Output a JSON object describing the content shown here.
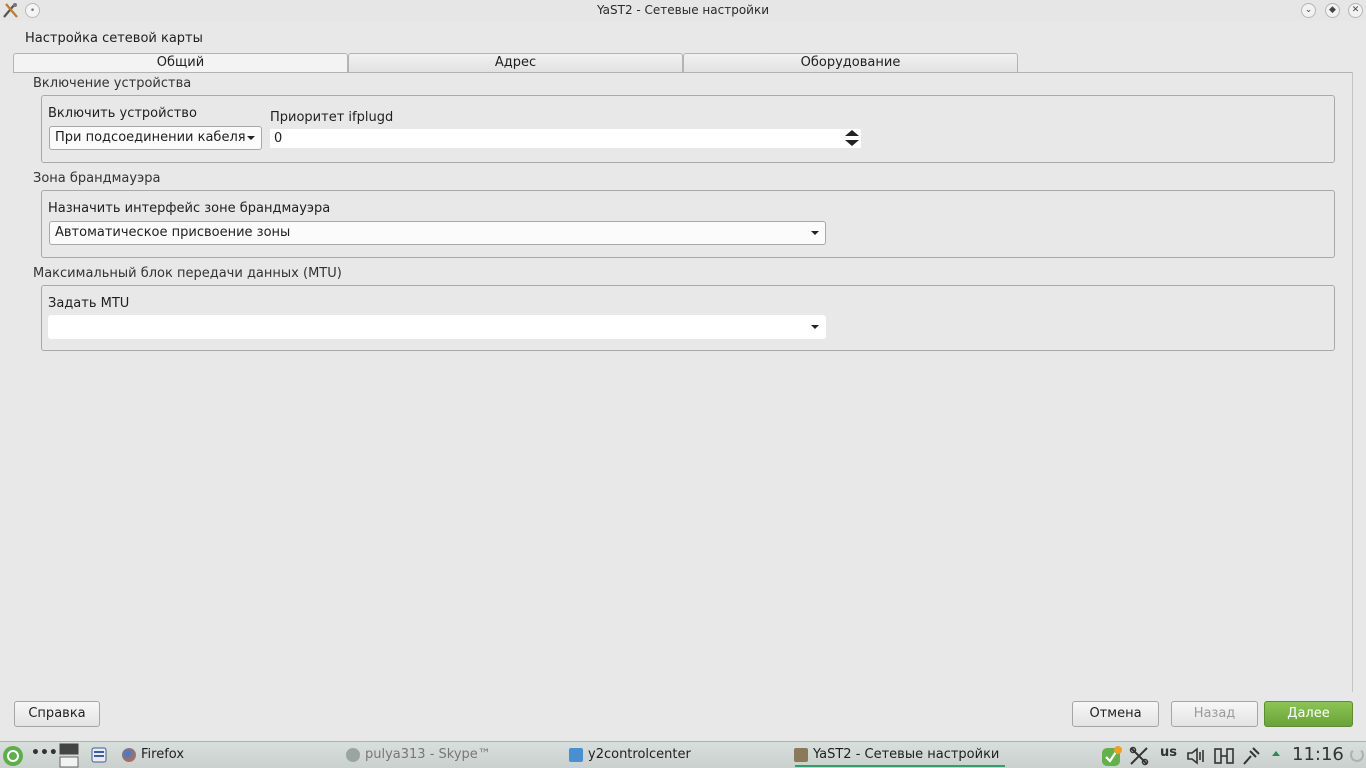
{
  "window": {
    "title": "YaST2 - Сетевые настройки",
    "app_icon": "yast-icon",
    "menu_icon": "window-menu-icon",
    "controls": [
      "minimize-icon",
      "maximize-icon",
      "close-icon"
    ]
  },
  "page_heading": "Настройка сетевой карты",
  "tabs": [
    {
      "label": "Общий",
      "active": true
    },
    {
      "label": "Адрес",
      "active": false
    },
    {
      "label": "Оборудование",
      "active": false
    }
  ],
  "sections": {
    "device_activation": {
      "title": "Включение устройства",
      "activate_label": "Включить устройство",
      "activate_value": "При подсоединении кабеля",
      "ifplugd_label": "Приоритет ifplugd",
      "ifplugd_value": "0"
    },
    "firewall": {
      "title": "Зона брандмауэра",
      "assign_label": "Назначить интерфейс зоне брандмауэра",
      "assign_value": "Автоматическое присвоение зоны"
    },
    "mtu": {
      "title": "Максимальный блок передачи данных (MTU)",
      "set_label": "Задать MTU",
      "set_value": ""
    }
  },
  "buttons": {
    "help": "Справка",
    "cancel": "Отмена",
    "back": "Назад",
    "next": "Далее"
  },
  "taskbar": {
    "tasks": [
      {
        "label": "Firefox",
        "icon": "firefox-icon"
      },
      {
        "label": "pulya313 - Skype™",
        "icon": "skype-icon"
      },
      {
        "label": "y2controlcenter",
        "icon": "yast-control-center-icon"
      },
      {
        "label": "YaST2 - Сетевые настройки",
        "icon": "yast-icon"
      }
    ],
    "keyboard_layout": "us",
    "clock": "11:16"
  },
  "colors": {
    "accent_green": "#6aa33a",
    "window_bg": "#e8e8e8"
  }
}
